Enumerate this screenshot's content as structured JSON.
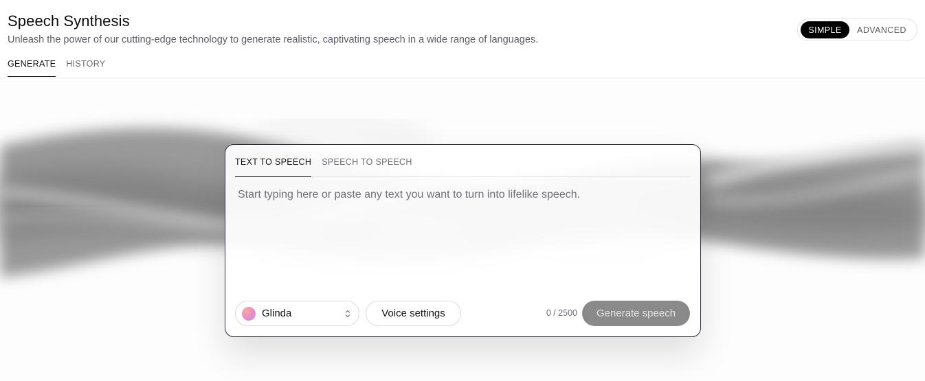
{
  "header": {
    "title": "Speech Synthesis",
    "subtitle": "Unleash the power of our cutting-edge technology to generate realistic, captivating speech in a wide range of languages.",
    "tabs": [
      {
        "label": "GENERATE",
        "active": true
      },
      {
        "label": "HISTORY",
        "active": false
      }
    ]
  },
  "mode_toggle": {
    "options": [
      "SIMPLE",
      "ADVANCED"
    ],
    "selected": "SIMPLE"
  },
  "card": {
    "tabs": [
      {
        "label": "TEXT TO SPEECH",
        "active": true
      },
      {
        "label": "SPEECH TO SPEECH",
        "active": false
      }
    ],
    "text_input": {
      "value": "",
      "placeholder": "Start typing here or paste any text you want to turn into lifelike speech."
    },
    "voice": {
      "name": "Glinda",
      "avatar_icon": "gradient-avatar-icon"
    },
    "voice_settings_label": "Voice settings",
    "char_count": "0 / 2500",
    "generate_label": "Generate speech"
  },
  "colors": {
    "accent": "#000000",
    "generate_disabled": "#8a8a8a",
    "card_border": "#2e2e38"
  }
}
